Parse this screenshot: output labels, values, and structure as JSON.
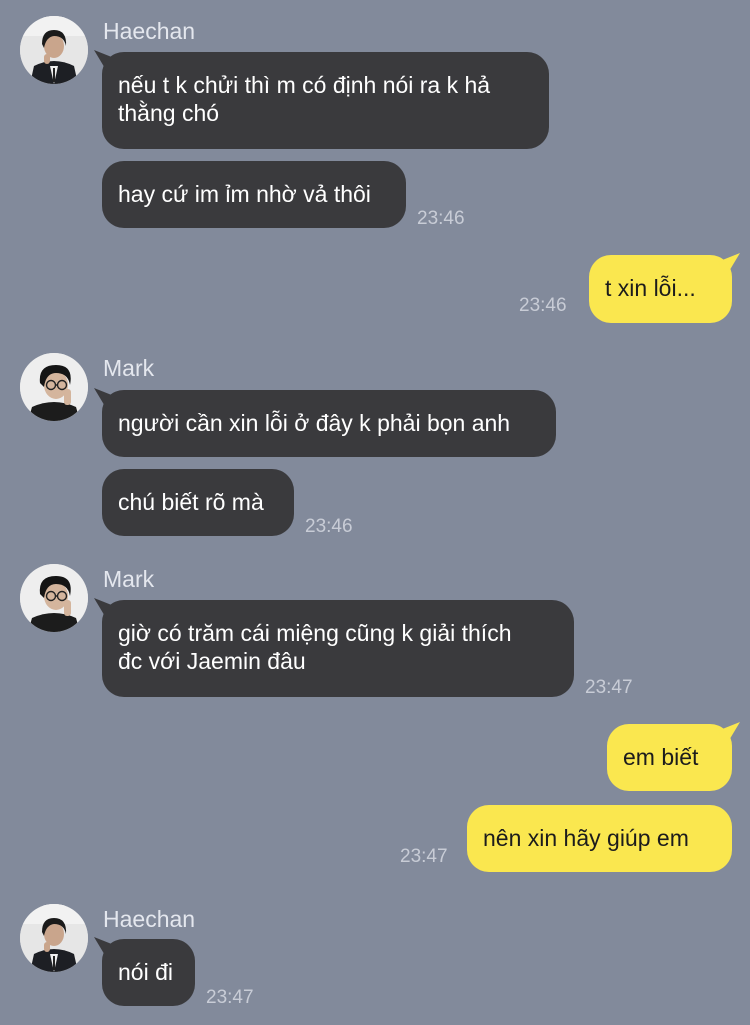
{
  "messages": {
    "g1": {
      "sender": "Haechan",
      "m1": "nếu t k chửi thì m có định nói ra k hả\nthằng chó",
      "m2": "hay cứ im ỉm nhờ vả thôi",
      "time": "23:46"
    },
    "me1": {
      "m1": "t xin lỗi...",
      "time": "23:46"
    },
    "g2": {
      "sender": "Mark",
      "m1": "người cần xin lỗi ở đây k phải bọn anh",
      "m2": "chú biết rõ mà",
      "time": "23:46"
    },
    "g3": {
      "sender": "Mark",
      "m1": "giờ có trăm cái miệng cũng k giải thích\nđc với Jaemin đâu",
      "time": "23:47"
    },
    "me2": {
      "m1": "em biết",
      "m2": "nên xin hãy giúp em",
      "time": "23:47"
    },
    "g4": {
      "sender": "Haechan",
      "m1": "nói đi",
      "time": "23:47"
    }
  },
  "colors": {
    "background": "#828a9b",
    "incoming_bubble": "#3a3a3d",
    "outgoing_bubble": "#fae74f"
  }
}
